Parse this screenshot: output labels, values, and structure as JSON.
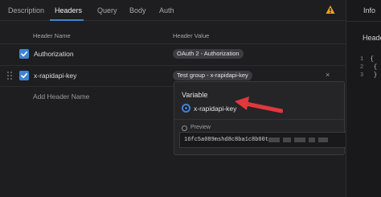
{
  "tabs": [
    {
      "label": "Description",
      "active": false
    },
    {
      "label": "Headers",
      "active": true
    },
    {
      "label": "Query",
      "active": false
    },
    {
      "label": "Body",
      "active": false
    },
    {
      "label": "Auth",
      "active": false
    }
  ],
  "columns": {
    "name": "Header Name",
    "value": "Header Value"
  },
  "headers": [
    {
      "enabled": true,
      "name": "Authorization",
      "value": "OAuth 2 - Authorization"
    },
    {
      "enabled": true,
      "name": "x-rapidapi-key",
      "value": "Test group - x-rapidapi-key"
    }
  ],
  "add_header_placeholder": "Add Header Name",
  "close_glyph": "×",
  "popover": {
    "title": "Variable",
    "selected_option": "x-rapidapi-key",
    "preview_label": "Preview",
    "preview_value": "16fc5a089mshd8c8ba1c8b00t"
  },
  "right_panel": {
    "tab": "Info",
    "heading": "Heade",
    "code_lines": [
      {
        "num": "1",
        "text": "{"
      },
      {
        "num": "2",
        "text": "{"
      },
      {
        "num": "3",
        "text": "}"
      }
    ]
  },
  "colors": {
    "accent": "#3d86d6",
    "arrow": "#e0383b",
    "warning": "#e6a817"
  },
  "icons": [
    "warning-icon",
    "checkmark-icon",
    "drag-handle-icon",
    "close-icon",
    "radio-selected-icon",
    "eye-icon",
    "annotation-arrow"
  ]
}
